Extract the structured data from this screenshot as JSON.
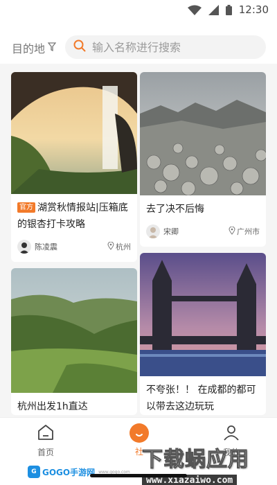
{
  "status_bar": {
    "time": "12:30",
    "icons": [
      "wifi-icon",
      "signal-icon",
      "battery-icon"
    ]
  },
  "search": {
    "destination_label": "目的地",
    "filter_icon": "filter-icon",
    "placeholder": "输入名称进行搜索",
    "search_icon": "search-icon"
  },
  "accent_color": "#f27a2a",
  "feed": {
    "left": [
      {
        "title": "湖赏秋情报站|压箱底的银杏打卡攻略",
        "tag": "官方",
        "author": "陈凌震",
        "location": "杭州",
        "image": "waterfall-cave-photo"
      },
      {
        "title": "杭州出发1h直达",
        "image": "green-valley-photo"
      }
    ],
    "right": [
      {
        "title": "去了决不后悔",
        "author": "宋卿",
        "location": "广州市",
        "image": "rocky-mountain-photo"
      },
      {
        "title": "不夸张！！ 在成都的都可以带去这边玩玩",
        "image": "tower-bridge-photo"
      }
    ]
  },
  "tabbar": {
    "home": {
      "label": "首页",
      "icon": "home-icon"
    },
    "community": {
      "label": "社",
      "icon": "community-icon"
    },
    "mine": {
      "label": "我的",
      "icon": "user-icon"
    }
  },
  "watermark": {
    "main": "下载蜗应用",
    "url": "www.xiazaiwo.com",
    "site": "GOGO手游网",
    "site_url": "www.gogo.com"
  }
}
